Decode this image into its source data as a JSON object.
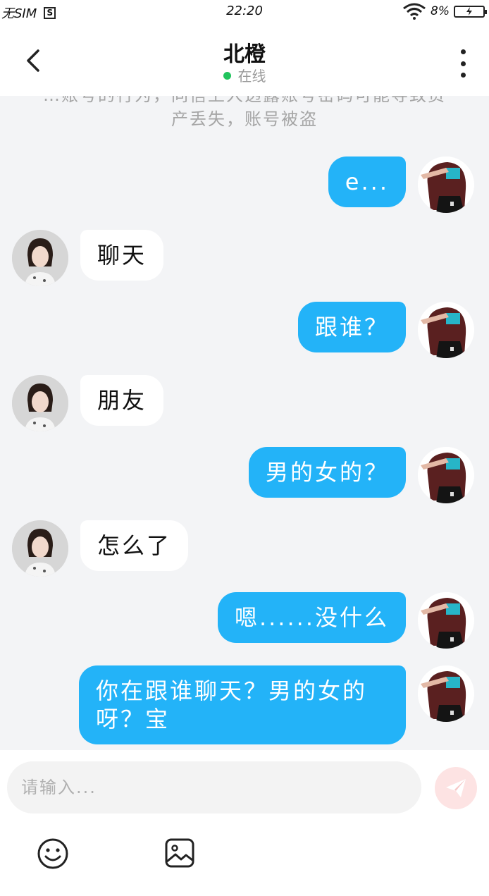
{
  "status_bar": {
    "carrier": "无SIM",
    "sim_icon_letter": "S",
    "time": "22:20",
    "battery": "8%"
  },
  "header": {
    "title": "北橙",
    "status": "在线",
    "status_color": "#21c45d"
  },
  "notice": "…账号的行为，同信上人透露账号密码可能导致资产丢失，账号被盗",
  "messages": [
    {
      "side": "me",
      "text": "e..."
    },
    {
      "side": "other",
      "text": "聊天"
    },
    {
      "side": "me",
      "text": "跟谁？"
    },
    {
      "side": "other",
      "text": "朋友"
    },
    {
      "side": "me",
      "text": "男的女的？"
    },
    {
      "side": "other",
      "text": "怎么了"
    },
    {
      "side": "me",
      "text": "嗯......没什么"
    },
    {
      "side": "me",
      "text": "你在跟谁聊天？男的女的呀？宝"
    }
  ],
  "input": {
    "placeholder": "请输入..."
  },
  "colors": {
    "my_bubble": "#23b3f8",
    "other_bubble": "#ffffff",
    "background": "#f3f4f6"
  },
  "icons": [
    "back-icon",
    "more-icon",
    "send-icon",
    "emoji-icon",
    "image-icon"
  ]
}
